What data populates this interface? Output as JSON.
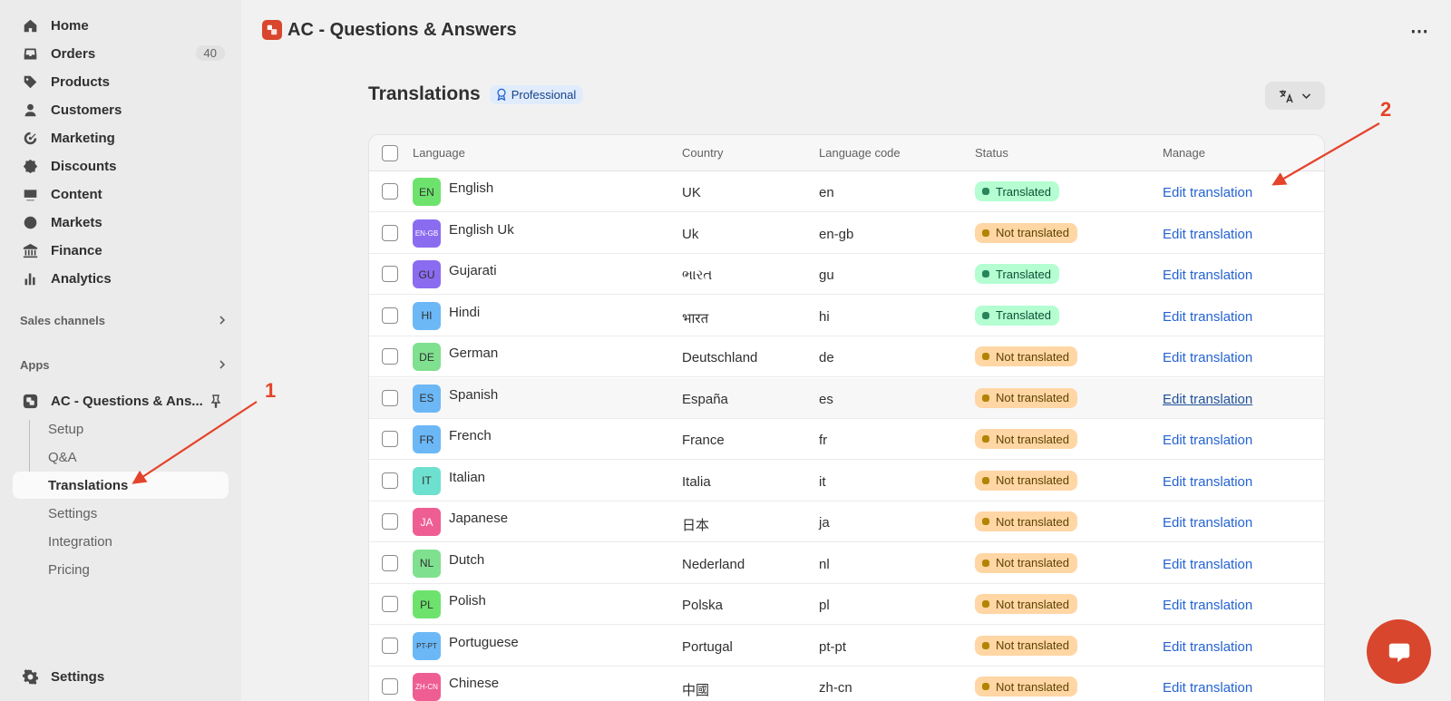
{
  "sidebar": {
    "nav": [
      {
        "label": "Home",
        "icon": "home-icon"
      },
      {
        "label": "Orders",
        "icon": "inbox-icon",
        "badge": "40"
      },
      {
        "label": "Products",
        "icon": "tag-icon"
      },
      {
        "label": "Customers",
        "icon": "person-icon"
      },
      {
        "label": "Marketing",
        "icon": "target-icon"
      },
      {
        "label": "Discounts",
        "icon": "discount-icon"
      },
      {
        "label": "Content",
        "icon": "image-icon"
      },
      {
        "label": "Markets",
        "icon": "globe-icon"
      },
      {
        "label": "Finance",
        "icon": "bank-icon"
      },
      {
        "label": "Analytics",
        "icon": "bar-chart-icon"
      }
    ],
    "sales_channels_label": "Sales channels",
    "apps_label": "Apps",
    "app_name": "AC - Questions & Ans...",
    "app_subitems": [
      "Setup",
      "Q&A",
      "Translations",
      "Settings",
      "Integration",
      "Pricing"
    ],
    "settings_label": "Settings"
  },
  "header": {
    "app_title": "AC - Questions & Answers",
    "more_label": "⋯"
  },
  "page": {
    "title": "Translations",
    "plan_badge": "Professional"
  },
  "table": {
    "columns": [
      "Language",
      "Country",
      "Language code",
      "Status",
      "Manage"
    ],
    "rows": [
      {
        "flag": "EN",
        "language": "English",
        "country": "UK",
        "code": "en",
        "status": "Translated",
        "manage": "Edit translation"
      },
      {
        "flag": "EN-GB",
        "language": "English Uk",
        "country": "Uk",
        "code": "en-gb",
        "status": "Not translated",
        "manage": "Edit translation"
      },
      {
        "flag": "GU",
        "language": "Gujarati",
        "country": "ભારત",
        "code": "gu",
        "status": "Translated",
        "manage": "Edit translation"
      },
      {
        "flag": "HI",
        "language": "Hindi",
        "country": "भारत",
        "code": "hi",
        "status": "Translated",
        "manage": "Edit translation"
      },
      {
        "flag": "DE",
        "language": "German",
        "country": "Deutschland",
        "code": "de",
        "status": "Not translated",
        "manage": "Edit translation"
      },
      {
        "flag": "ES",
        "language": "Spanish",
        "country": "España",
        "code": "es",
        "status": "Not translated",
        "manage": "Edit translation"
      },
      {
        "flag": "FR",
        "language": "French",
        "country": "France",
        "code": "fr",
        "status": "Not translated",
        "manage": "Edit translation"
      },
      {
        "flag": "IT",
        "language": "Italian",
        "country": "Italia",
        "code": "it",
        "status": "Not translated",
        "manage": "Edit translation"
      },
      {
        "flag": "JA",
        "language": "Japanese",
        "country": "日本",
        "code": "ja",
        "status": "Not translated",
        "manage": "Edit translation"
      },
      {
        "flag": "NL",
        "language": "Dutch",
        "country": "Nederland",
        "code": "nl",
        "status": "Not translated",
        "manage": "Edit translation"
      },
      {
        "flag": "PL",
        "language": "Polish",
        "country": "Polska",
        "code": "pl",
        "status": "Not translated",
        "manage": "Edit translation"
      },
      {
        "flag": "PT-PT",
        "language": "Portuguese",
        "country": "Portugal",
        "code": "pt-pt",
        "status": "Not translated",
        "manage": "Edit translation"
      },
      {
        "flag": "ZH-CN",
        "language": "Chinese",
        "country": "中國",
        "code": "zh-cn",
        "status": "Not translated",
        "manage": "Edit translation"
      }
    ]
  },
  "annotations": [
    "1",
    "2"
  ],
  "colors": {
    "accent_red": "#d8462d",
    "link_blue": "#2463d1",
    "translated_bg": "#b4fed2",
    "not_translated_bg": "#ffd6a4"
  }
}
